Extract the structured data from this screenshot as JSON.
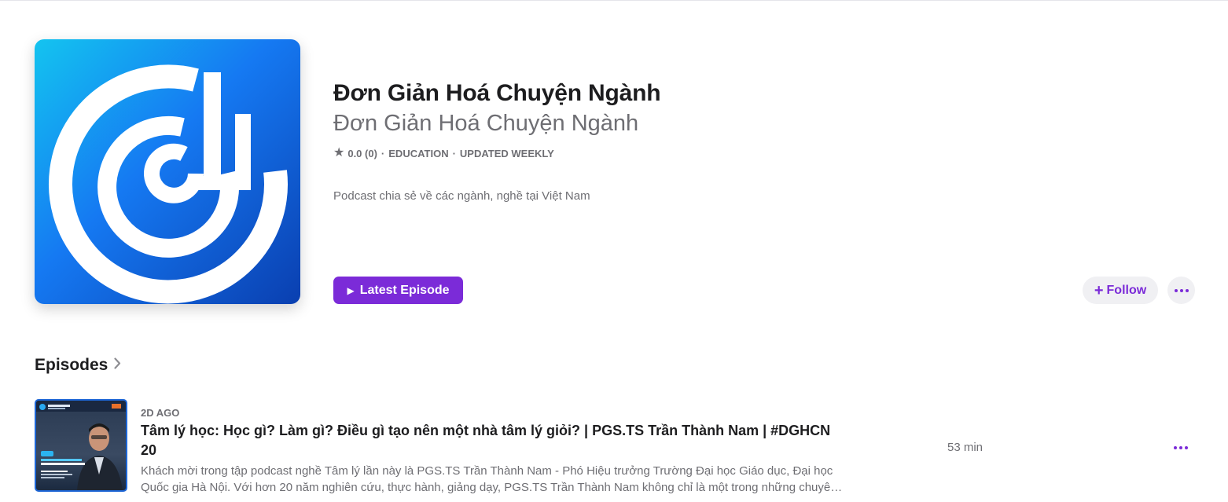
{
  "podcast": {
    "title": "Đơn Giản Hoá Chuyện Ngành",
    "author": "Đơn Giản Hoá Chuyện Ngành",
    "rating": "0.0 (0)",
    "category": "EDUCATION",
    "update_frequency": "UPDATED WEEKLY",
    "description": "Podcast chia sẻ về các ngành, nghề tại Việt Nam",
    "artwork_icon": "dghcn-logo"
  },
  "actions": {
    "latest_episode_label": "Latest Episode",
    "follow_label": "Follow",
    "more_icon": "ellipsis-icon"
  },
  "episodes_section": {
    "heading": "Episodes"
  },
  "episodes": [
    {
      "date": "2D AGO",
      "title": "Tâm lý học: Học gì? Làm gì? Điều gì tạo nên một nhà tâm lý giỏi? | PGS.TS Trần Thành Nam | #DGHCN 20",
      "description": "Khách mời trong tập podcast nghề Tâm lý lần này là PGS.TS Trần Thành Nam - Phó Hiệu trưởng Trường Đại học Giáo dục, Đại học Quốc gia Hà Nội. Với hơn 20 năm nghiên cứu, thực hành, giảng dạy, PGS.TS Trần Thành Nam không chỉ là một trong những chuyên gia hàng đầu",
      "duration": "53 min",
      "thumbnail_badge": "Tập 20"
    }
  ],
  "colors": {
    "accent": "#7b2bd8",
    "text_primary": "#1d1d1f",
    "text_secondary": "#6e6e73",
    "button_bg": "#f0f0f3"
  }
}
